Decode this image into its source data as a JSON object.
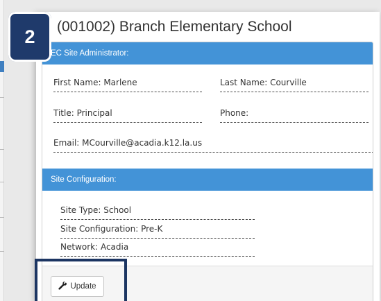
{
  "badge": {
    "number": "2"
  },
  "dialog": {
    "title": "(001002) Branch Elementary School"
  },
  "admin_panel": {
    "heading": "EC Site Administrator:",
    "first_name": "First Name: Marlene",
    "last_name": "Last Name: Courville",
    "title": "Title: Principal",
    "phone": "Phone:",
    "email": "Email: MCourville@acadia.k12.la.us"
  },
  "config_panel": {
    "heading": "Site Configuration:",
    "site_type": "Site Type: School",
    "site_configuration": "Site Configuration: Pre-K",
    "network": "Network: Acadia"
  },
  "footer": {
    "update_label": "Update"
  },
  "colors": {
    "accent": "#4393d7",
    "badge": "#1f3a6b"
  }
}
